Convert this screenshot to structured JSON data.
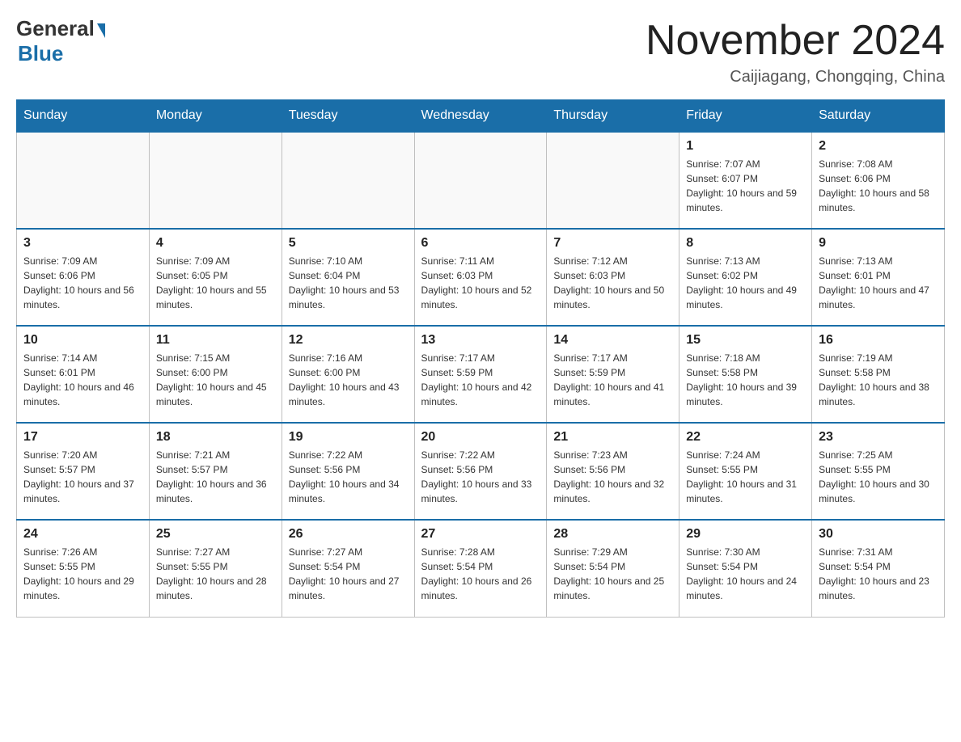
{
  "header": {
    "logo_general": "General",
    "logo_blue": "Blue",
    "month_title": "November 2024",
    "location": "Caijiagang, Chongqing, China"
  },
  "days_of_week": [
    "Sunday",
    "Monday",
    "Tuesday",
    "Wednesday",
    "Thursday",
    "Friday",
    "Saturday"
  ],
  "weeks": [
    [
      {
        "day": "",
        "sunrise": "",
        "sunset": "",
        "daylight": ""
      },
      {
        "day": "",
        "sunrise": "",
        "sunset": "",
        "daylight": ""
      },
      {
        "day": "",
        "sunrise": "",
        "sunset": "",
        "daylight": ""
      },
      {
        "day": "",
        "sunrise": "",
        "sunset": "",
        "daylight": ""
      },
      {
        "day": "",
        "sunrise": "",
        "sunset": "",
        "daylight": ""
      },
      {
        "day": "1",
        "sunrise": "Sunrise: 7:07 AM",
        "sunset": "Sunset: 6:07 PM",
        "daylight": "Daylight: 10 hours and 59 minutes."
      },
      {
        "day": "2",
        "sunrise": "Sunrise: 7:08 AM",
        "sunset": "Sunset: 6:06 PM",
        "daylight": "Daylight: 10 hours and 58 minutes."
      }
    ],
    [
      {
        "day": "3",
        "sunrise": "Sunrise: 7:09 AM",
        "sunset": "Sunset: 6:06 PM",
        "daylight": "Daylight: 10 hours and 56 minutes."
      },
      {
        "day": "4",
        "sunrise": "Sunrise: 7:09 AM",
        "sunset": "Sunset: 6:05 PM",
        "daylight": "Daylight: 10 hours and 55 minutes."
      },
      {
        "day": "5",
        "sunrise": "Sunrise: 7:10 AM",
        "sunset": "Sunset: 6:04 PM",
        "daylight": "Daylight: 10 hours and 53 minutes."
      },
      {
        "day": "6",
        "sunrise": "Sunrise: 7:11 AM",
        "sunset": "Sunset: 6:03 PM",
        "daylight": "Daylight: 10 hours and 52 minutes."
      },
      {
        "day": "7",
        "sunrise": "Sunrise: 7:12 AM",
        "sunset": "Sunset: 6:03 PM",
        "daylight": "Daylight: 10 hours and 50 minutes."
      },
      {
        "day": "8",
        "sunrise": "Sunrise: 7:13 AM",
        "sunset": "Sunset: 6:02 PM",
        "daylight": "Daylight: 10 hours and 49 minutes."
      },
      {
        "day": "9",
        "sunrise": "Sunrise: 7:13 AM",
        "sunset": "Sunset: 6:01 PM",
        "daylight": "Daylight: 10 hours and 47 minutes."
      }
    ],
    [
      {
        "day": "10",
        "sunrise": "Sunrise: 7:14 AM",
        "sunset": "Sunset: 6:01 PM",
        "daylight": "Daylight: 10 hours and 46 minutes."
      },
      {
        "day": "11",
        "sunrise": "Sunrise: 7:15 AM",
        "sunset": "Sunset: 6:00 PM",
        "daylight": "Daylight: 10 hours and 45 minutes."
      },
      {
        "day": "12",
        "sunrise": "Sunrise: 7:16 AM",
        "sunset": "Sunset: 6:00 PM",
        "daylight": "Daylight: 10 hours and 43 minutes."
      },
      {
        "day": "13",
        "sunrise": "Sunrise: 7:17 AM",
        "sunset": "Sunset: 5:59 PM",
        "daylight": "Daylight: 10 hours and 42 minutes."
      },
      {
        "day": "14",
        "sunrise": "Sunrise: 7:17 AM",
        "sunset": "Sunset: 5:59 PM",
        "daylight": "Daylight: 10 hours and 41 minutes."
      },
      {
        "day": "15",
        "sunrise": "Sunrise: 7:18 AM",
        "sunset": "Sunset: 5:58 PM",
        "daylight": "Daylight: 10 hours and 39 minutes."
      },
      {
        "day": "16",
        "sunrise": "Sunrise: 7:19 AM",
        "sunset": "Sunset: 5:58 PM",
        "daylight": "Daylight: 10 hours and 38 minutes."
      }
    ],
    [
      {
        "day": "17",
        "sunrise": "Sunrise: 7:20 AM",
        "sunset": "Sunset: 5:57 PM",
        "daylight": "Daylight: 10 hours and 37 minutes."
      },
      {
        "day": "18",
        "sunrise": "Sunrise: 7:21 AM",
        "sunset": "Sunset: 5:57 PM",
        "daylight": "Daylight: 10 hours and 36 minutes."
      },
      {
        "day": "19",
        "sunrise": "Sunrise: 7:22 AM",
        "sunset": "Sunset: 5:56 PM",
        "daylight": "Daylight: 10 hours and 34 minutes."
      },
      {
        "day": "20",
        "sunrise": "Sunrise: 7:22 AM",
        "sunset": "Sunset: 5:56 PM",
        "daylight": "Daylight: 10 hours and 33 minutes."
      },
      {
        "day": "21",
        "sunrise": "Sunrise: 7:23 AM",
        "sunset": "Sunset: 5:56 PM",
        "daylight": "Daylight: 10 hours and 32 minutes."
      },
      {
        "day": "22",
        "sunrise": "Sunrise: 7:24 AM",
        "sunset": "Sunset: 5:55 PM",
        "daylight": "Daylight: 10 hours and 31 minutes."
      },
      {
        "day": "23",
        "sunrise": "Sunrise: 7:25 AM",
        "sunset": "Sunset: 5:55 PM",
        "daylight": "Daylight: 10 hours and 30 minutes."
      }
    ],
    [
      {
        "day": "24",
        "sunrise": "Sunrise: 7:26 AM",
        "sunset": "Sunset: 5:55 PM",
        "daylight": "Daylight: 10 hours and 29 minutes."
      },
      {
        "day": "25",
        "sunrise": "Sunrise: 7:27 AM",
        "sunset": "Sunset: 5:55 PM",
        "daylight": "Daylight: 10 hours and 28 minutes."
      },
      {
        "day": "26",
        "sunrise": "Sunrise: 7:27 AM",
        "sunset": "Sunset: 5:54 PM",
        "daylight": "Daylight: 10 hours and 27 minutes."
      },
      {
        "day": "27",
        "sunrise": "Sunrise: 7:28 AM",
        "sunset": "Sunset: 5:54 PM",
        "daylight": "Daylight: 10 hours and 26 minutes."
      },
      {
        "day": "28",
        "sunrise": "Sunrise: 7:29 AM",
        "sunset": "Sunset: 5:54 PM",
        "daylight": "Daylight: 10 hours and 25 minutes."
      },
      {
        "day": "29",
        "sunrise": "Sunrise: 7:30 AM",
        "sunset": "Sunset: 5:54 PM",
        "daylight": "Daylight: 10 hours and 24 minutes."
      },
      {
        "day": "30",
        "sunrise": "Sunrise: 7:31 AM",
        "sunset": "Sunset: 5:54 PM",
        "daylight": "Daylight: 10 hours and 23 minutes."
      }
    ]
  ]
}
